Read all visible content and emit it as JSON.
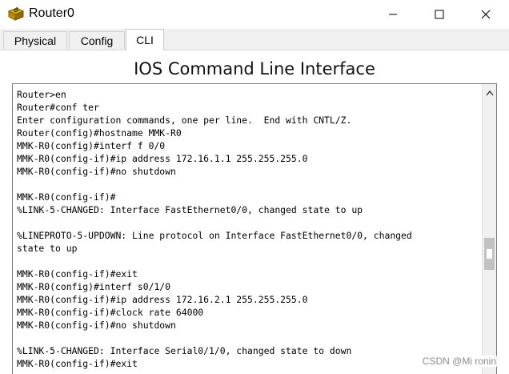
{
  "window": {
    "title": "Router0",
    "icon": "router-icon"
  },
  "tabs": [
    {
      "label": "Physical",
      "active": false
    },
    {
      "label": "Config",
      "active": false
    },
    {
      "label": "CLI",
      "active": true
    }
  ],
  "main": {
    "heading": "IOS Command Line Interface"
  },
  "console": {
    "lines": [
      "Router>en",
      "Router#conf ter",
      "Enter configuration commands, one per line.  End with CNTL/Z.",
      "Router(config)#hostname MMK-R0",
      "MMK-R0(config)#interf f 0/0",
      "MMK-R0(config-if)#ip address 172.16.1.1 255.255.255.0",
      "MMK-R0(config-if)#no shutdown",
      "",
      "MMK-R0(config-if)#",
      "%LINK-5-CHANGED: Interface FastEthernet0/0, changed state to up",
      "",
      "%LINEPROTO-5-UPDOWN: Line protocol on Interface FastEthernet0/0, changed",
      "state to up",
      "",
      "MMK-R0(config-if)#exit",
      "MMK-R0(config)#interf s0/1/0",
      "MMK-R0(config-if)#ip address 172.16.2.1 255.255.255.0",
      "MMK-R0(config-if)#clock rate 64000",
      "MMK-R0(config-if)#no shutdown",
      "",
      "%LINK-5-CHANGED: Interface Serial0/1/0, changed state to down",
      "MMK-R0(config-if)#exit"
    ]
  },
  "watermark": "CSDN @Mi ronin",
  "colors": {
    "tab_strip": "#f0f0f0",
    "console_border": "#7a7a7a",
    "scroll_thumb": "#c2c2c2"
  }
}
